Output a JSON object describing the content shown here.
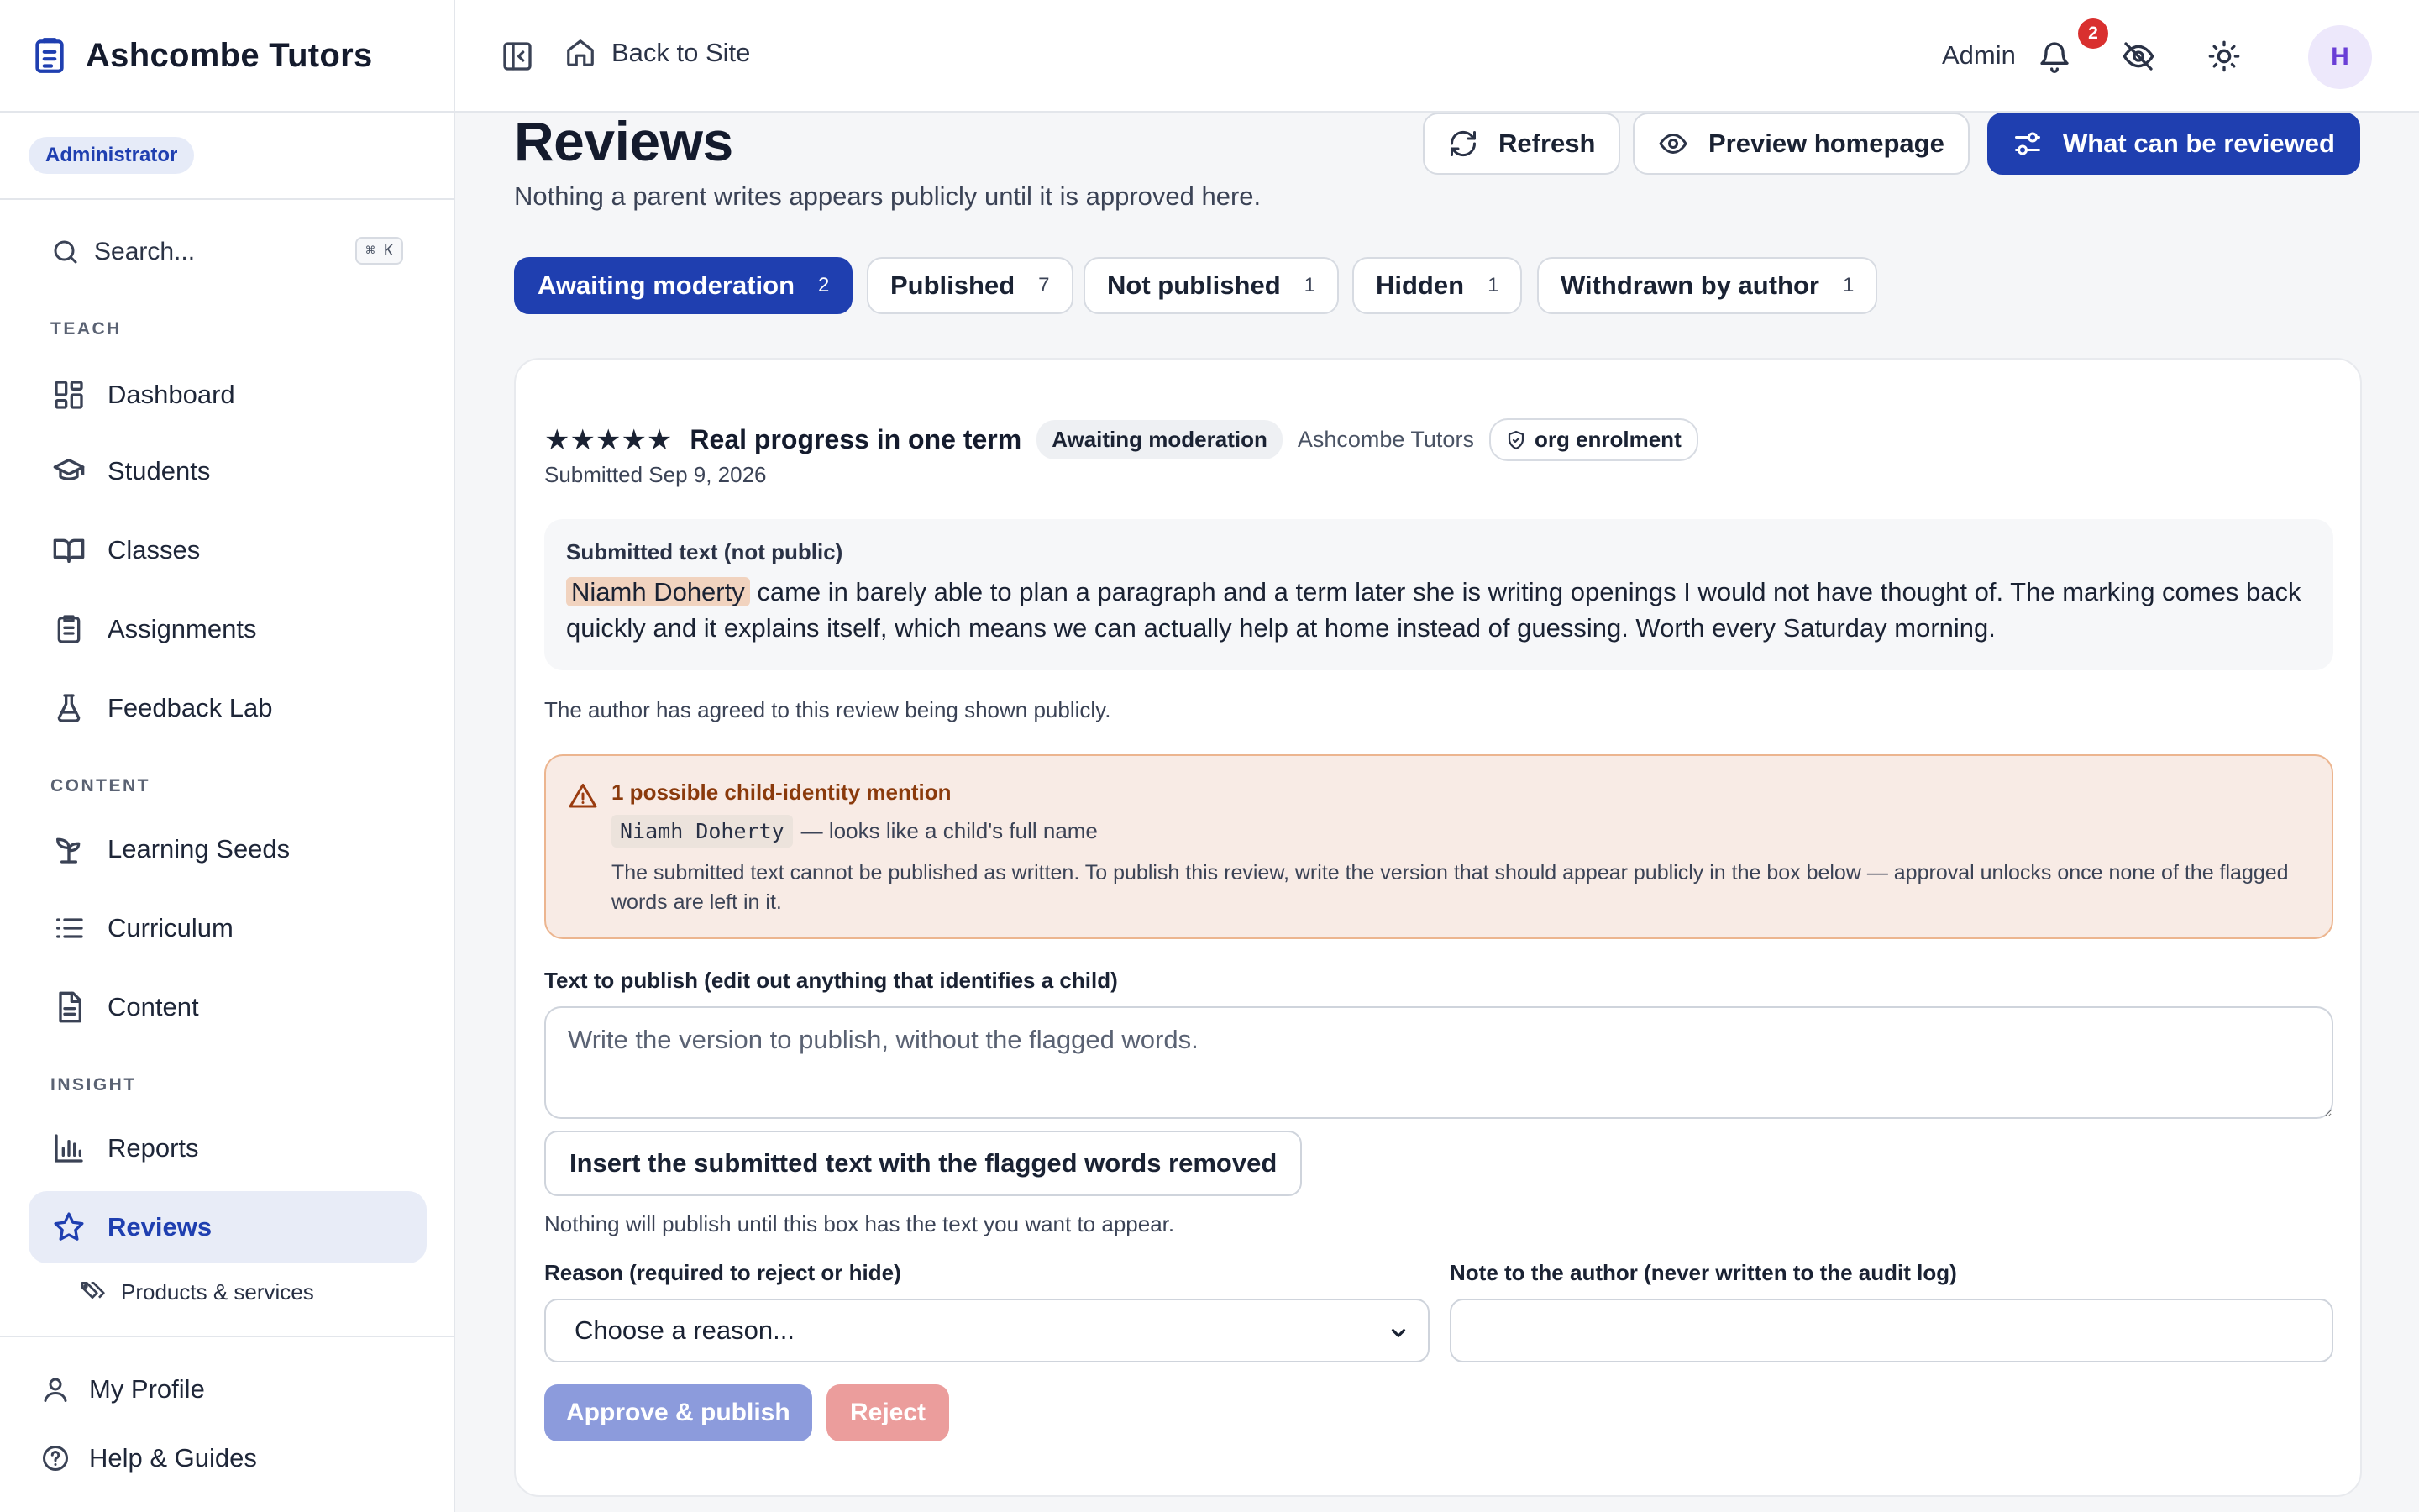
{
  "brand": {
    "name": "Ashcombe Tutors",
    "logo_icon": "clipboard-list-icon"
  },
  "role_badge": "Administrator",
  "search": {
    "label": "Search...",
    "shortcut": "⌘ K"
  },
  "nav": {
    "teach_label": "TEACH",
    "content_label": "CONTENT",
    "insight_label": "INSIGHT",
    "items": [
      {
        "label": "Dashboard",
        "icon": "dashboard-icon"
      },
      {
        "label": "Students",
        "icon": "graduation-cap-icon"
      },
      {
        "label": "Classes",
        "icon": "book-open-icon"
      },
      {
        "label": "Assignments",
        "icon": "clipboard-icon"
      },
      {
        "label": "Feedback Lab",
        "icon": "flask-icon"
      },
      {
        "label": "Learning Seeds",
        "icon": "sprout-icon"
      },
      {
        "label": "Curriculum",
        "icon": "list-icon"
      },
      {
        "label": "Content",
        "icon": "file-text-icon"
      },
      {
        "label": "Reports",
        "icon": "bar-chart-icon"
      },
      {
        "label": "Reviews",
        "icon": "star-icon",
        "active": true
      }
    ],
    "sub_item": {
      "label": "Products & services",
      "icon": "tags-icon"
    },
    "footer": [
      {
        "label": "My Profile",
        "icon": "user-icon"
      },
      {
        "label": "Help & Guides",
        "icon": "help-circle-icon"
      }
    ]
  },
  "topbar": {
    "back_label": "Back to Site",
    "admin_label": "Admin",
    "notification_count": "2",
    "avatar_initial": "H"
  },
  "page": {
    "title": "Reviews",
    "subtitle": "Nothing a parent writes appears publicly until it is approved here.",
    "refresh_label": "Refresh",
    "preview_label": "Preview homepage",
    "what_label": "What can be reviewed"
  },
  "tabs": [
    {
      "label": "Awaiting moderation",
      "count": "2",
      "active": true
    },
    {
      "label": "Published",
      "count": "7"
    },
    {
      "label": "Not published",
      "count": "1"
    },
    {
      "label": "Hidden",
      "count": "1"
    },
    {
      "label": "Withdrawn by author",
      "count": "1"
    }
  ],
  "review": {
    "stars": "★★★★★",
    "rating": 5,
    "title": "Real progress in one term",
    "status": "Awaiting moderation",
    "org": "Ashcombe Tutors",
    "source": "org enrolment",
    "submitted": "Submitted Sep 9, 2026",
    "submitted_label": "Submitted text (not public)",
    "flagged_name": "Niamh Doherty",
    "body_rest": " came in barely able to plan a paragraph and a term later she is writing openings I would not have thought of. The marking comes back quickly and it explains itself, which means we can actually help at home instead of guessing. Worth every Saturday morning.",
    "consent": "The author has agreed to this review being shown publicly.",
    "warning": {
      "title": "1 possible child-identity mention",
      "flagged": "Niamh Doherty",
      "flag_note": "— looks like a child's full name",
      "description": "The submitted text cannot be published as written. To publish this review, write the version that should appear publicly in the box below — approval unlocks once none of the flagged words are left in it."
    },
    "publish_label": "Text to publish (edit out anything that identifies a child)",
    "publish_placeholder": "Write the version to publish, without the flagged words.",
    "insert_label": "Insert the submitted text with the flagged words removed",
    "help_text": "Nothing will publish until this box has the text you want to appear.",
    "reason_label": "Reason (required to reject or hide)",
    "reason_value": "Choose a reason...",
    "note_label": "Note to the author (never written to the audit log)",
    "note_value": "",
    "approve_label": "Approve & publish",
    "reject_label": "Reject"
  },
  "colors": {
    "primary": "#1f3fb0",
    "warning_bg": "#f8ebe5",
    "warning_border": "#ecb58f",
    "flag_highlight": "#f1d3bf",
    "notification": "#d9302f"
  }
}
